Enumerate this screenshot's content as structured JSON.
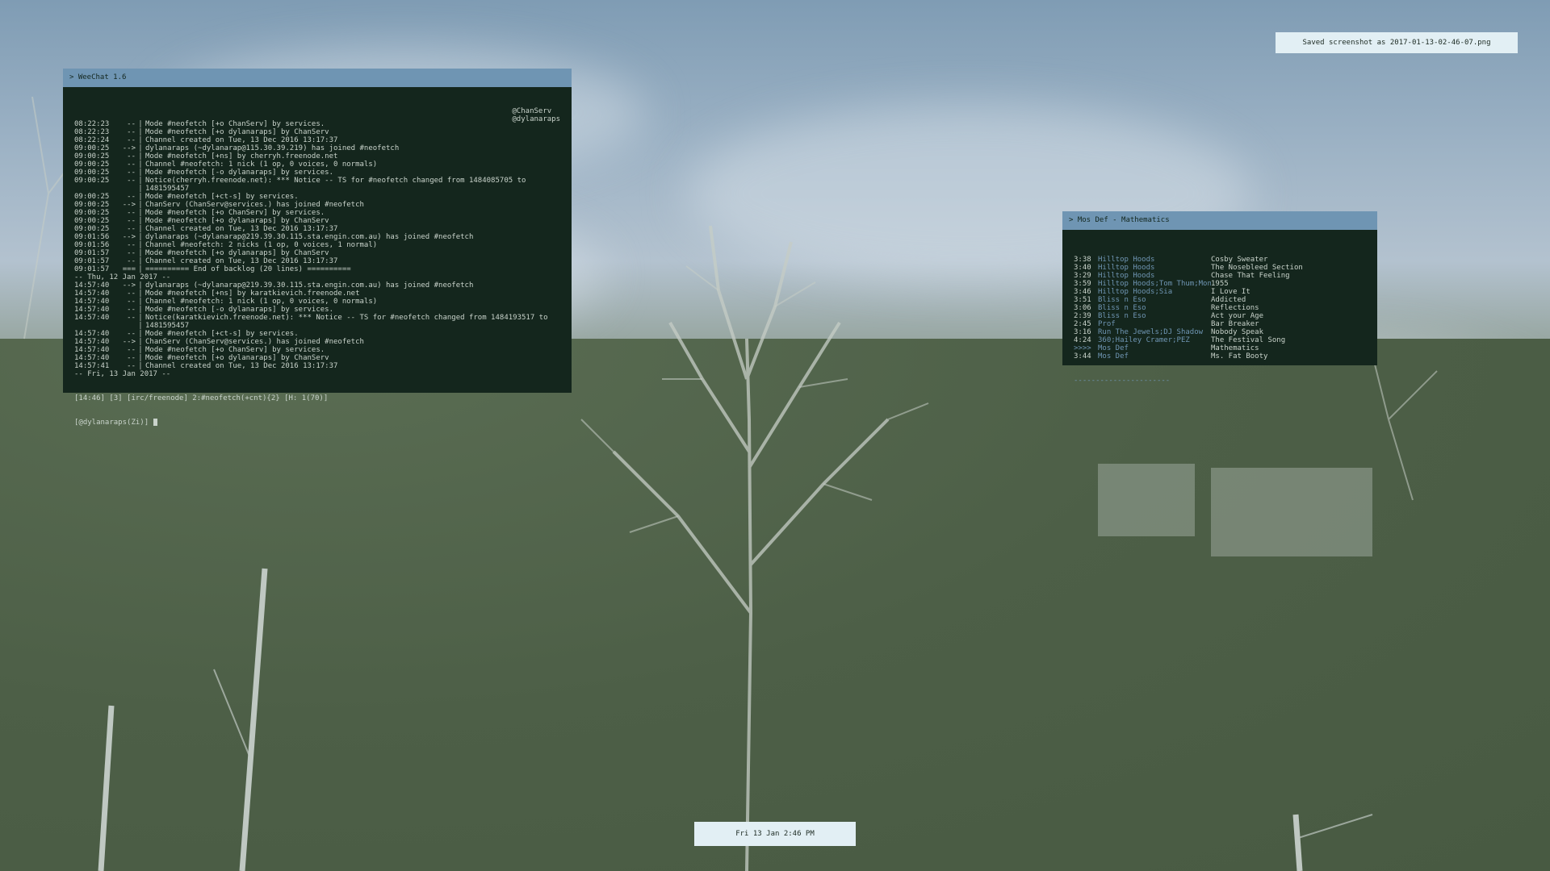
{
  "weechat": {
    "title": "> WeeChat 1.6",
    "nicklist": [
      "@ChanServ",
      "@dylanaraps"
    ],
    "lines": [
      {
        "time": "08:22:23",
        "prefix": "--",
        "text": "Mode #neofetch [+o ChanServ] by services."
      },
      {
        "time": "08:22:23",
        "prefix": "--",
        "text": "Mode #neofetch [+o dylanaraps] by ChanServ"
      },
      {
        "time": "08:22:24",
        "prefix": "--",
        "text": "Channel created on Tue, 13 Dec 2016 13:17:37"
      },
      {
        "time": "09:00:25",
        "prefix": "-->",
        "text": "dylanaraps (~dylanarap@115.30.39.219) has joined #neofetch"
      },
      {
        "time": "09:00:25",
        "prefix": "--",
        "text": "Mode #neofetch [+ns] by cherryh.freenode.net"
      },
      {
        "time": "09:00:25",
        "prefix": "--",
        "text": "Channel #neofetch: 1 nick (1 op, 0 voices, 0 normals)"
      },
      {
        "time": "09:00:25",
        "prefix": "--",
        "text": "Mode #neofetch [-o dylanaraps] by services."
      },
      {
        "time": "09:00:25",
        "prefix": "--",
        "text": "Notice(cherryh.freenode.net): *** Notice -- TS for #neofetch changed from 1484085705 to"
      },
      {
        "time": "",
        "prefix": "",
        "text": "1481595457"
      },
      {
        "time": "09:00:25",
        "prefix": "--",
        "text": "Mode #neofetch [+ct-s] by services."
      },
      {
        "time": "09:00:25",
        "prefix": "-->",
        "text": "ChanServ (ChanServ@services.) has joined #neofetch"
      },
      {
        "time": "09:00:25",
        "prefix": "--",
        "text": "Mode #neofetch [+o ChanServ] by services."
      },
      {
        "time": "09:00:25",
        "prefix": "--",
        "text": "Mode #neofetch [+o dylanaraps] by ChanServ"
      },
      {
        "time": "09:00:25",
        "prefix": "--",
        "text": "Channel created on Tue, 13 Dec 2016 13:17:37"
      },
      {
        "time": "09:01:56",
        "prefix": "-->",
        "text": "dylanaraps (~dylanarap@219.39.30.115.sta.engin.com.au) has joined #neofetch"
      },
      {
        "time": "09:01:56",
        "prefix": "--",
        "text": "Channel #neofetch: 2 nicks (1 op, 0 voices, 1 normal)"
      },
      {
        "time": "09:01:57",
        "prefix": "--",
        "text": "Mode #neofetch [+o dylanaraps] by ChanServ"
      },
      {
        "time": "09:01:57",
        "prefix": "--",
        "text": "Channel created on Tue, 13 Dec 2016 13:17:37"
      },
      {
        "time": "09:01:57",
        "prefix": "===",
        "text": "========== End of backlog (20 lines) =========="
      },
      {
        "time": "",
        "prefix": "",
        "text": "-- Thu, 12 Jan 2017 --",
        "full": true
      },
      {
        "time": "14:57:40",
        "prefix": "-->",
        "text": "dylanaraps (~dylanarap@219.39.30.115.sta.engin.com.au) has joined #neofetch"
      },
      {
        "time": "14:57:40",
        "prefix": "--",
        "text": "Mode #neofetch [+ns] by karatkievich.freenode.net"
      },
      {
        "time": "14:57:40",
        "prefix": "--",
        "text": "Channel #neofetch: 1 nick (1 op, 0 voices, 0 normals)"
      },
      {
        "time": "14:57:40",
        "prefix": "--",
        "text": "Mode #neofetch [-o dylanaraps] by services."
      },
      {
        "time": "14:57:40",
        "prefix": "--",
        "text": "Notice(karatkievich.freenode.net): *** Notice -- TS for #neofetch changed from 1484193517 to"
      },
      {
        "time": "",
        "prefix": "",
        "text": "1481595457"
      },
      {
        "time": "14:57:40",
        "prefix": "--",
        "text": "Mode #neofetch [+ct-s] by services."
      },
      {
        "time": "14:57:40",
        "prefix": "-->",
        "text": "ChanServ (ChanServ@services.) has joined #neofetch"
      },
      {
        "time": "14:57:40",
        "prefix": "--",
        "text": "Mode #neofetch [+o ChanServ] by services."
      },
      {
        "time": "14:57:40",
        "prefix": "--",
        "text": "Mode #neofetch [+o dylanaraps] by ChanServ"
      },
      {
        "time": "14:57:41",
        "prefix": "--",
        "text": "Channel created on Tue, 13 Dec 2016 13:17:37"
      },
      {
        "time": "",
        "prefix": "",
        "text": "-- Fri, 13 Jan 2017 --",
        "full": true
      }
    ],
    "status_bar": "[14:46] [3] [irc/freenode] 2:#neofetch(+cnt){2} [H: 1(70)]",
    "input_prompt": "[@dylanaraps(Zi)]"
  },
  "music": {
    "title": "> Mos Def - Mathematics",
    "tracks": [
      {
        "dur": "3:38",
        "artist": "Hilltop Hoods",
        "title": "Cosby Sweater"
      },
      {
        "dur": "3:40",
        "artist": "Hilltop Hoods",
        "title": "The Nosebleed Section"
      },
      {
        "dur": "3:29",
        "artist": "Hilltop Hoods",
        "title": "Chase That Feeling"
      },
      {
        "dur": "3:59",
        "artist": "Hilltop Hoods;Tom Thum;Mont",
        "title": "1955"
      },
      {
        "dur": "3:46",
        "artist": "Hilltop Hoods;Sia",
        "title": "I Love It"
      },
      {
        "dur": "3:51",
        "artist": "Bliss n Eso",
        "title": "Addicted"
      },
      {
        "dur": "3:06",
        "artist": "Bliss n Eso",
        "title": "Reflections"
      },
      {
        "dur": "2:39",
        "artist": "Bliss n Eso",
        "title": "Act your Age"
      },
      {
        "dur": "2:45",
        "artist": "Prof",
        "title": "Bar Breaker"
      },
      {
        "dur": "3:16",
        "artist": "Run The Jewels;DJ Shadow",
        "title": "Nobody Speak"
      },
      {
        "dur": "4:24",
        "artist": "360;Hailey Cramer;PEZ",
        "title": "The Festival Song"
      },
      {
        "dur": ">>>>",
        "artist": "Mos Def",
        "title": "Mathematics"
      },
      {
        "dur": "3:44",
        "artist": "Mos Def",
        "title": "Ms. Fat Booty"
      }
    ],
    "divider": "----------------------"
  },
  "notifications": {
    "screenshot": "Saved screenshot as 2017-01-13-02-46-07.png",
    "clock": "Fri 13 Jan  2:46 PM"
  },
  "colors": {
    "accent": "#6f95b3",
    "terminal_bg": "#14261d",
    "terminal_fg": "#c9d3cb",
    "notification_bg": "#e2eff4"
  }
}
